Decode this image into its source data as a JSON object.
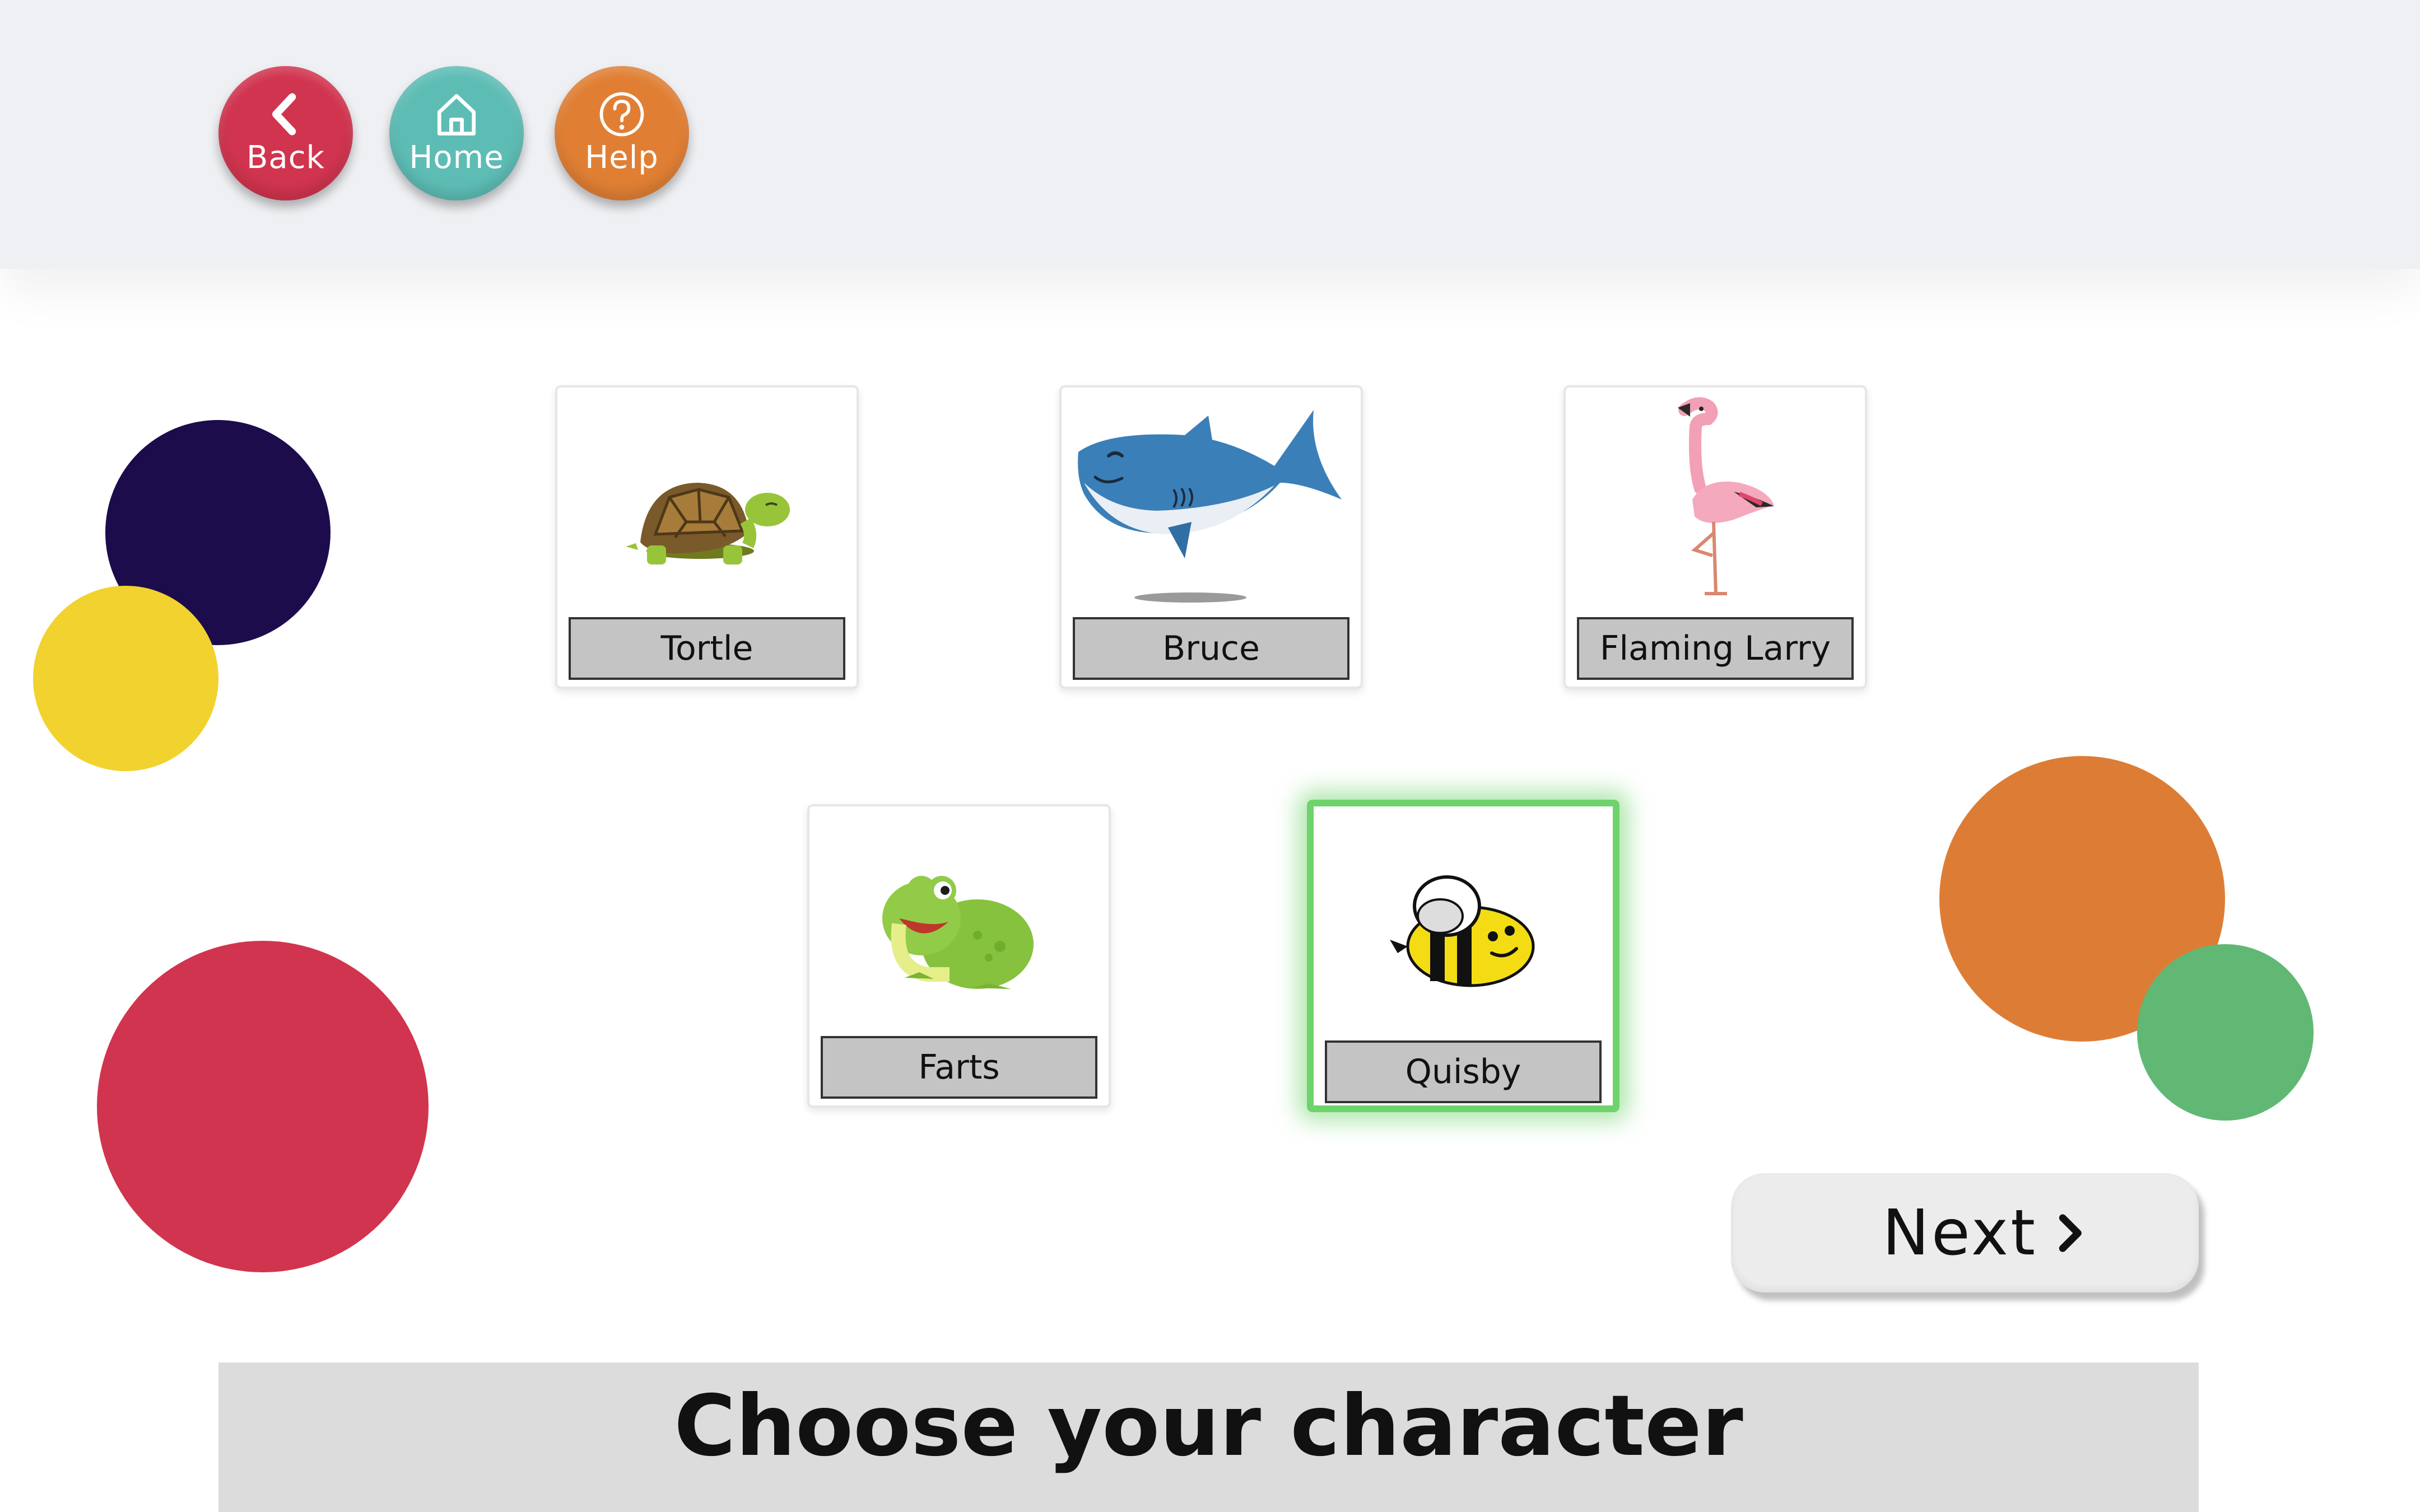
{
  "nav": {
    "back_label": "Back",
    "home_label": "Home",
    "help_label": "Help"
  },
  "characters": [
    {
      "name": "Tortle",
      "icon": "turtle-icon",
      "selected": false
    },
    {
      "name": "Bruce",
      "icon": "shark-icon",
      "selected": false
    },
    {
      "name": "Flaming Larry",
      "icon": "flamingo-icon",
      "selected": false
    },
    {
      "name": "Farts",
      "icon": "frog-icon",
      "selected": false
    },
    {
      "name": "Quisby",
      "icon": "bee-icon",
      "selected": true
    }
  ],
  "next": {
    "label": "Next"
  },
  "footer": {
    "title": "Choose your character"
  },
  "colors": {
    "back": "#d1344e",
    "home": "#5dbdb5",
    "help": "#e07f34",
    "selected_glow": "#6ed36b",
    "navy": "#1c0c4c",
    "yellow": "#f2d22e",
    "red": "#d1344e",
    "orange": "#dd7d35",
    "green": "#60b874"
  }
}
